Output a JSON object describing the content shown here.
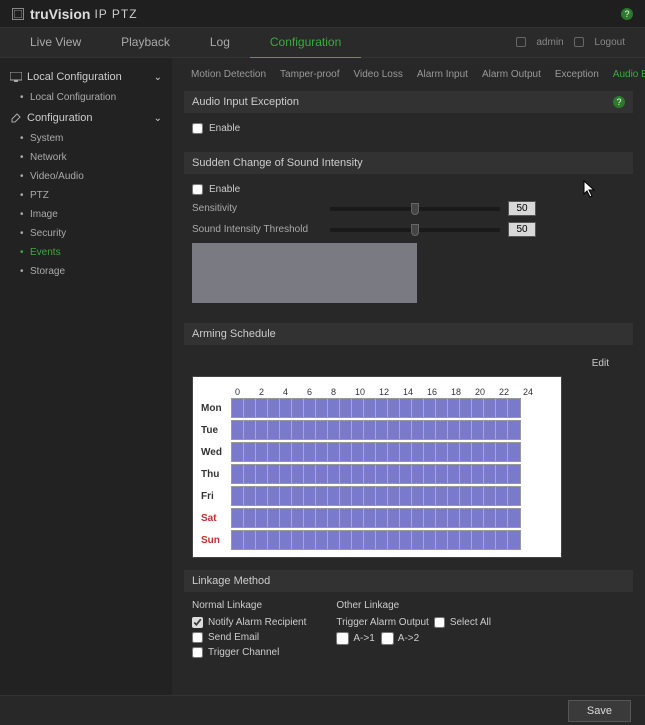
{
  "brand": {
    "prefix": "tru",
    "name": "Vision",
    "sub": "IP PTZ"
  },
  "nav": {
    "tabs": [
      "Live View",
      "Playback",
      "Log",
      "Configuration"
    ],
    "active": 3,
    "user": "admin",
    "logout": "Logout"
  },
  "sidebar": {
    "groups": [
      {
        "label": "Local Configuration",
        "items": [
          "Local Configuration"
        ],
        "icon": "monitor"
      },
      {
        "label": "Configuration",
        "items": [
          "System",
          "Network",
          "Video/Audio",
          "PTZ",
          "Image",
          "Security",
          "Events",
          "Storage"
        ],
        "activeItem": 6,
        "icon": "wrench"
      }
    ]
  },
  "subtabs": {
    "items": [
      "Motion Detection",
      "Tamper-proof",
      "Video Loss",
      "Alarm Input",
      "Alarm Output",
      "Exception",
      "Audio Exception Detection"
    ],
    "active": 6
  },
  "sections": {
    "audioInput": {
      "title": "Audio Input Exception",
      "enableLabel": "Enable",
      "enabled": false
    },
    "sudden": {
      "title": "Sudden Change of Sound Intensity",
      "enableLabel": "Enable",
      "enabled": false,
      "sensitivityLabel": "Sensitivity",
      "sensitivity": 50,
      "thresholdLabel": "Sound Intensity Threshold",
      "threshold": 50
    },
    "arming": {
      "title": "Arming Schedule",
      "editLabel": "Edit",
      "hours": [
        "0",
        "2",
        "4",
        "6",
        "8",
        "10",
        "12",
        "14",
        "16",
        "18",
        "20",
        "22",
        "24"
      ],
      "days": [
        "Mon",
        "Tue",
        "Wed",
        "Thu",
        "Fri",
        "Sat",
        "Sun"
      ]
    },
    "linkage": {
      "title": "Linkage Method",
      "normalTitle": "Normal Linkage",
      "otherTitle": "Other Linkage",
      "normal": [
        {
          "label": "Notify Alarm Recipient",
          "checked": true
        },
        {
          "label": "Send Email",
          "checked": false
        },
        {
          "label": "Trigger Channel",
          "checked": false
        }
      ],
      "triggerLabel": "Trigger Alarm Output",
      "selectAll": {
        "label": "Select All",
        "checked": false
      },
      "outputs": [
        {
          "label": "A->1",
          "checked": false
        },
        {
          "label": "A->2",
          "checked": false
        }
      ]
    }
  },
  "footer": {
    "save": "Save"
  }
}
